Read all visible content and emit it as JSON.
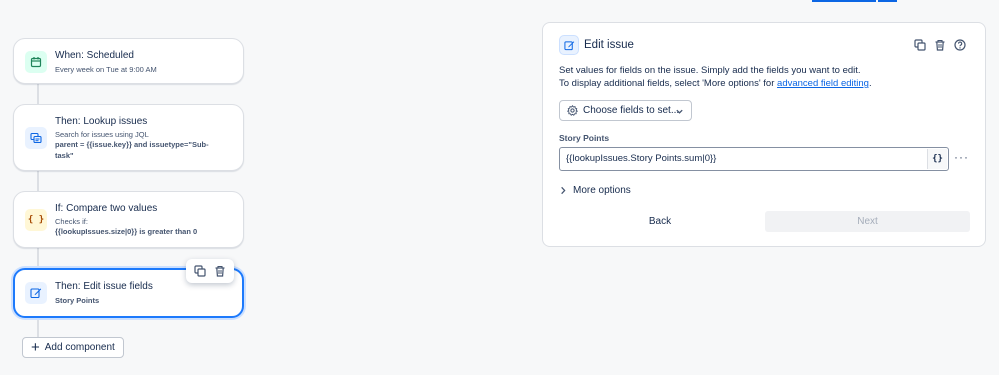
{
  "flow": {
    "cards": [
      {
        "title": "When: Scheduled",
        "subtitle": "Every week on Tue at 9:00 AM",
        "icon": "calendar-icon"
      },
      {
        "title": "Then: Lookup issues",
        "subtitle": "Search for issues using JQL",
        "detail": "parent = {{issue.key}} and issuetype=\"Sub-task\"",
        "icon": "lookup-issues-icon"
      },
      {
        "title": "If: Compare two values",
        "subtitle": "Checks if:",
        "detail": "{{lookupIssues.size|0}} is greater than 0",
        "icon": "curly-braces-icon"
      },
      {
        "title": "Then: Edit issue fields",
        "detail": "Story Points",
        "icon": "edit-icon"
      }
    ],
    "toolbar": {
      "duplicate_icon": "copy-icon",
      "delete_icon": "trash-icon"
    },
    "add_component_label": "Add component"
  },
  "panel": {
    "title": "Edit issue",
    "header_icons": [
      "copy-icon",
      "trash-icon",
      "help-icon"
    ],
    "description_line1": "Set values for fields on the issue. Simply add the fields you want to edit.",
    "description_line2_prefix": "To display additional fields, select 'More options' for ",
    "description_link": "advanced field editing",
    "description_line2_suffix": ".",
    "choose_fields_label": "Choose fields to set...",
    "field_label": "Story Points",
    "field_value": "{{lookupIssues.Story Points.sum|0}}",
    "smart_value_button": "{}",
    "more_button": "···",
    "more_options_label": "More options",
    "back_label": "Back",
    "next_label": "Next"
  },
  "colors": {
    "accent": "#1d7afc",
    "link": "#0c66e4",
    "calendar_bg": "#dcfff1",
    "compare_bg": "#fff7d6",
    "action_bg": "#e9f2ff"
  }
}
